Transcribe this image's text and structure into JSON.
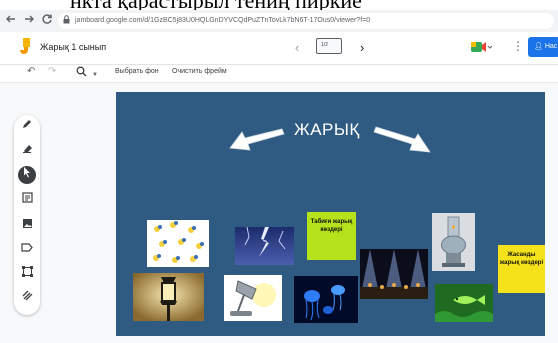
{
  "caption": "нкта қарастырыл тениң пиркие",
  "browser": {
    "back_icon": "arrow-left-icon",
    "forward_icon": "arrow-right-icon",
    "reload_icon": "reload-icon",
    "url": "jamboard.google.com/d/1GzBC5j83U0HQLGnDYVCQdPuZTnTovLk7bN6T-17Ous0/viewer?f=0"
  },
  "header": {
    "title": "Жарық 1 сынып",
    "frame_label": "1/2",
    "share_label": "Нас"
  },
  "toolbar": {
    "set_background": "Выбрать фон",
    "clear_frame": "Очистить фрейм"
  },
  "sidetools": [
    "pen-icon",
    "eraser-icon",
    "select-icon",
    "sticky-note-icon",
    "image-icon",
    "shape-icon",
    "textbox-icon",
    "laser-icon"
  ],
  "board": {
    "title": "ЖАРЫҚ",
    "background": "#2f5b82",
    "stickies": [
      {
        "text": "Табиғи жарық көздері",
        "color": "#b6e21b"
      },
      {
        "text": "Жасанды жарық көздері",
        "color": "#f5e21a"
      }
    ]
  }
}
